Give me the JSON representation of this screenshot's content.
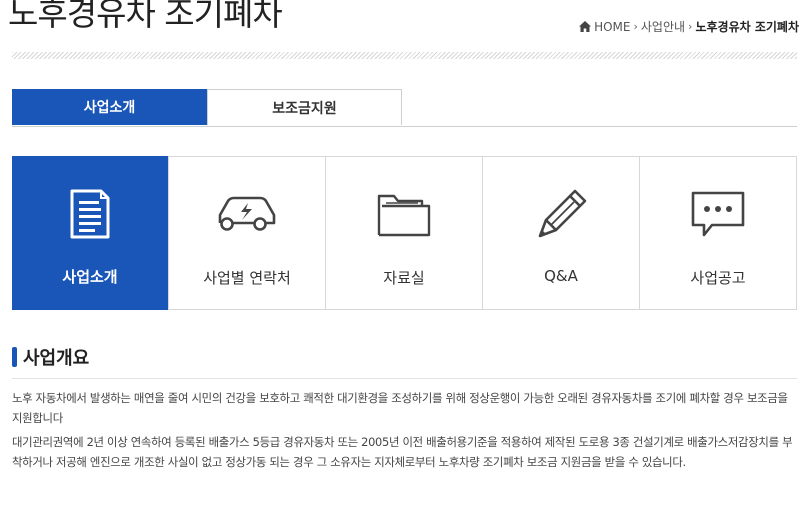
{
  "header": {
    "title": "노후경유차 조기폐차",
    "breadcrumb": {
      "home": "HOME",
      "section": "사업안내",
      "current": "노후경유차 조기폐차"
    }
  },
  "tabs": [
    {
      "label": "사업소개",
      "active": true
    },
    {
      "label": "보조금지원",
      "active": false
    }
  ],
  "tiles": [
    {
      "label": "사업소개",
      "icon": "document-icon",
      "active": true
    },
    {
      "label": "사업별 연락처",
      "icon": "car-icon",
      "active": false
    },
    {
      "label": "자료실",
      "icon": "folder-icon",
      "active": false
    },
    {
      "label": "Q&A",
      "icon": "pencil-icon",
      "active": false
    },
    {
      "label": "사업공고",
      "icon": "speech-bubble-icon",
      "active": false
    }
  ],
  "section": {
    "heading": "사업개요",
    "paragraphs": [
      "노후 자동차에서 발생하는 매연을 줄여 시민의 건강을 보호하고 쾌적한 대기환경을 조성하기를 위해 정상운행이 가능한 오래된 경유자동차를 조기에 폐차할 경우 보조금을 지원합니다",
      "대기관리권역에 2년 이상 연속하여 등록된 배출가스 5등급 경유자동차 또는 2005년 이전 배출허용기준을 적용하여 제작된 도로용 3종 건설기계로 배출가스저감장치를 부착하거나 저공해 엔진으로 개조한 사실이 없고 정상가동 되는 경우 그 소유자는 지자체로부터 노후차량 조기폐차 보조금 지원금을 받을 수 있습니다."
    ]
  },
  "colors": {
    "accent": "#1a55b8",
    "text": "#333333",
    "border": "#d8d8d8"
  }
}
